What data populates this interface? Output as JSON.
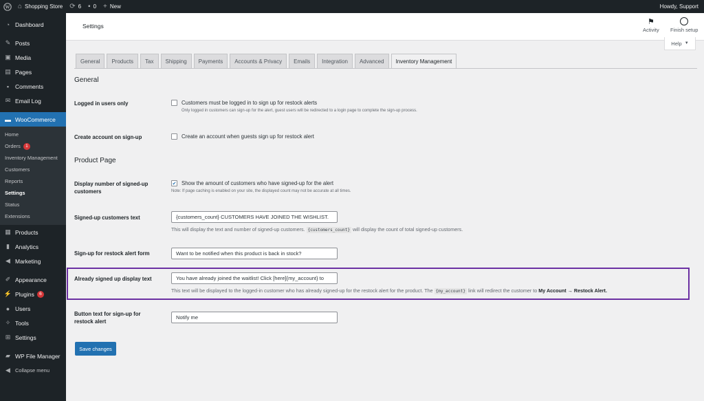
{
  "adminbar": {
    "site_name": "Shopping Store",
    "updates_count": "6",
    "comments_count": "0",
    "new_label": "New",
    "howdy": "Howdy, Support"
  },
  "sidebar": {
    "dashboard": "Dashboard",
    "posts": "Posts",
    "media": "Media",
    "pages": "Pages",
    "comments": "Comments",
    "email_log": "Email Log",
    "woocommerce": "WooCommerce",
    "sub": {
      "home": "Home",
      "orders": "Orders",
      "orders_badge": "1",
      "inventory": "Inventory Management",
      "customers": "Customers",
      "reports": "Reports",
      "settings": "Settings",
      "status": "Status",
      "extensions": "Extensions"
    },
    "products": "Products",
    "analytics": "Analytics",
    "marketing": "Marketing",
    "appearance": "Appearance",
    "plugins": "Plugins",
    "plugins_badge": "6",
    "users": "Users",
    "tools": "Tools",
    "settings": "Settings",
    "wp_file_manager": "WP File Manager",
    "collapse": "Collapse menu"
  },
  "header": {
    "title": "Settings",
    "activity": "Activity",
    "finish_setup": "Finish setup",
    "help": "Help"
  },
  "tabs": [
    "General",
    "Products",
    "Tax",
    "Shipping",
    "Payments",
    "Accounts & Privacy",
    "Emails",
    "Integration",
    "Advanced",
    "Inventory Management"
  ],
  "sections": {
    "general": "General",
    "product_page": "Product Page"
  },
  "fields": {
    "logged_in": {
      "label": "Logged in users only",
      "checkbox_label": "Customers must be logged in to sign up for restock alerts",
      "checked": false,
      "description": "Only logged in customers can sign-up for the alert, guest users will be redirected to a login page to complete the sign-up process."
    },
    "create_account": {
      "label": "Create account on sign-up",
      "checkbox_label": "Create an account when guests sign up for restock alert",
      "checked": false
    },
    "display_number": {
      "label": "Display number of signed-up customers",
      "checkbox_label": "Show the amount of customers who have signed-up for the alert",
      "checked": true,
      "description": "Note: If page caching is enabled on your site, the displayed count may not be accurate at all times."
    },
    "signed_up_text": {
      "label": "Signed-up customers text",
      "value": "{customers_count} CUSTOMERS HAVE JOINED THE WISHLIST.",
      "desc_pre": "This will display the text and number of signed-up customers.",
      "desc_code": "{customers_count}",
      "desc_post": "will display the count of total signed-up customers."
    },
    "signup_form": {
      "label": "Sign-up for restock alert form",
      "value": "Want to be notified when this product is back in stock?"
    },
    "already_signed": {
      "label": "Already signed up display text",
      "value": "You have already joined the waitlist! Click [here]{my_account} to",
      "desc_pre": "This text will be displayed to the logged-in customer who has already signed-up for the restock alert for the product. The",
      "desc_code": "{my_account}",
      "desc_mid": "link will redirect the customer to",
      "desc_strong": "My Account → Restock Alert."
    },
    "button_text": {
      "label": "Button text for sign-up for restock alert",
      "value": "Notify me"
    }
  },
  "save_button": "Save changes",
  "colors": {
    "highlight": "#6b2fa2",
    "primary": "#2271b1",
    "admin_dark": "#1d2327"
  }
}
